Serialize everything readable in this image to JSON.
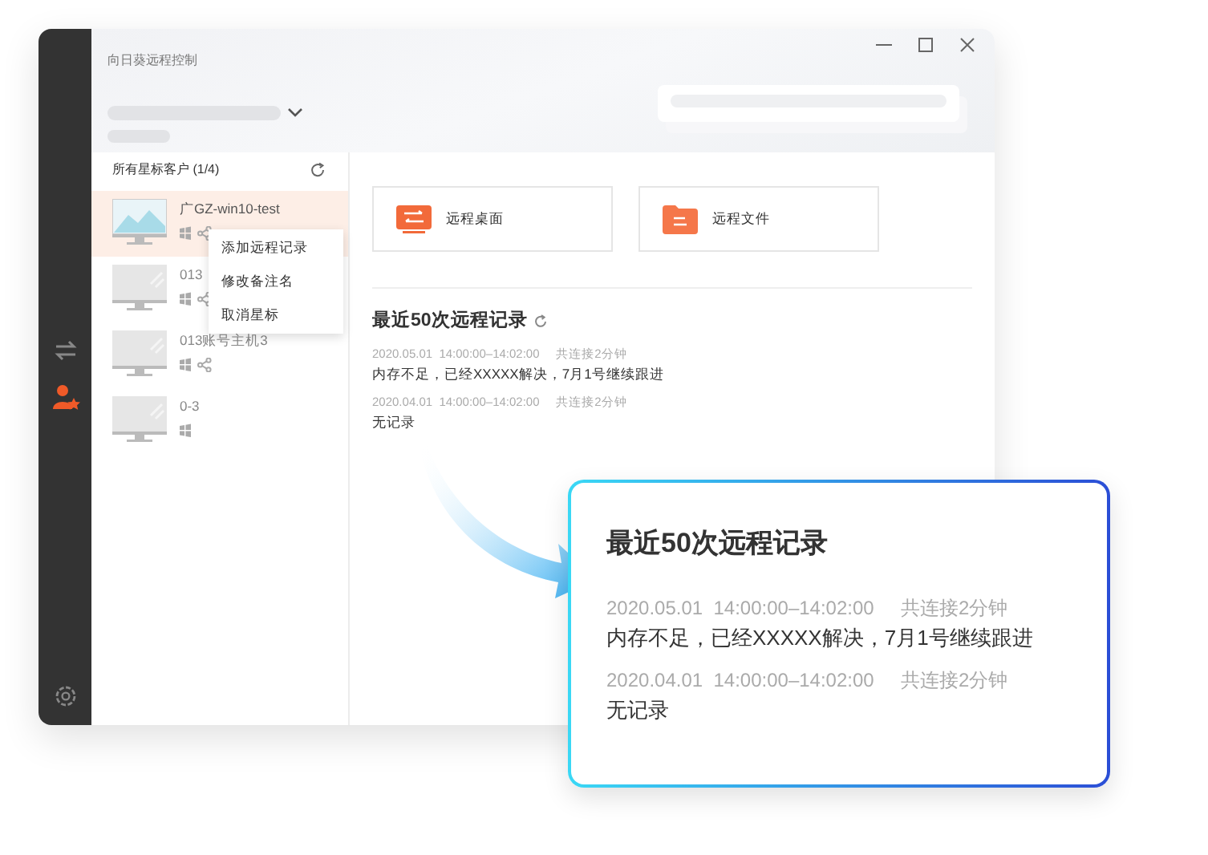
{
  "window": {
    "title": "向日葵远程控制"
  },
  "sidebar": {
    "items": [
      {
        "kind": "swap",
        "selected": false
      },
      {
        "kind": "starred",
        "selected": true
      }
    ]
  },
  "client_list": {
    "heading": "所有星标客户 (1/4)",
    "clients": [
      {
        "name": "广GZ-win10-test",
        "selected": true,
        "kind": "preview",
        "shared": true
      },
      {
        "name": "013",
        "selected": false,
        "kind": "blank",
        "shared": true
      },
      {
        "name": "013账号主机3",
        "selected": false,
        "kind": "blank",
        "shared": true
      },
      {
        "name": "0-3",
        "selected": false,
        "kind": "blank",
        "shared": false
      }
    ]
  },
  "context_menu": {
    "items": [
      "添加远程记录",
      "修改备注名",
      "取消星标"
    ]
  },
  "actions": [
    {
      "label": "远程桌面",
      "kind": "desktop"
    },
    {
      "label": "远程文件",
      "kind": "files"
    }
  ],
  "history": {
    "title": "最近50次远程记录",
    "records": [
      {
        "date": "2020.05.01",
        "time": "14:00:00–14:02:00",
        "duration": "共连接2分钟",
        "note": "内存不足，已经XXXXX解决，7月1号继续跟进"
      },
      {
        "date": "2020.04.01",
        "time": "14:00:00–14:02:00",
        "duration": "共连接2分钟",
        "note": "无记录"
      }
    ]
  },
  "callout": {
    "title": "最近50次远程记录",
    "records": [
      {
        "date": "2020.05.01",
        "time": "14:00:00–14:02:00",
        "duration": "共连接2分钟",
        "note": "内存不足，已经XXXXX解决，7月1号继续跟进"
      },
      {
        "date": "2020.04.01",
        "time": "14:00:00–14:02:00",
        "duration": "共连接2分钟",
        "note": "无记录"
      }
    ]
  }
}
